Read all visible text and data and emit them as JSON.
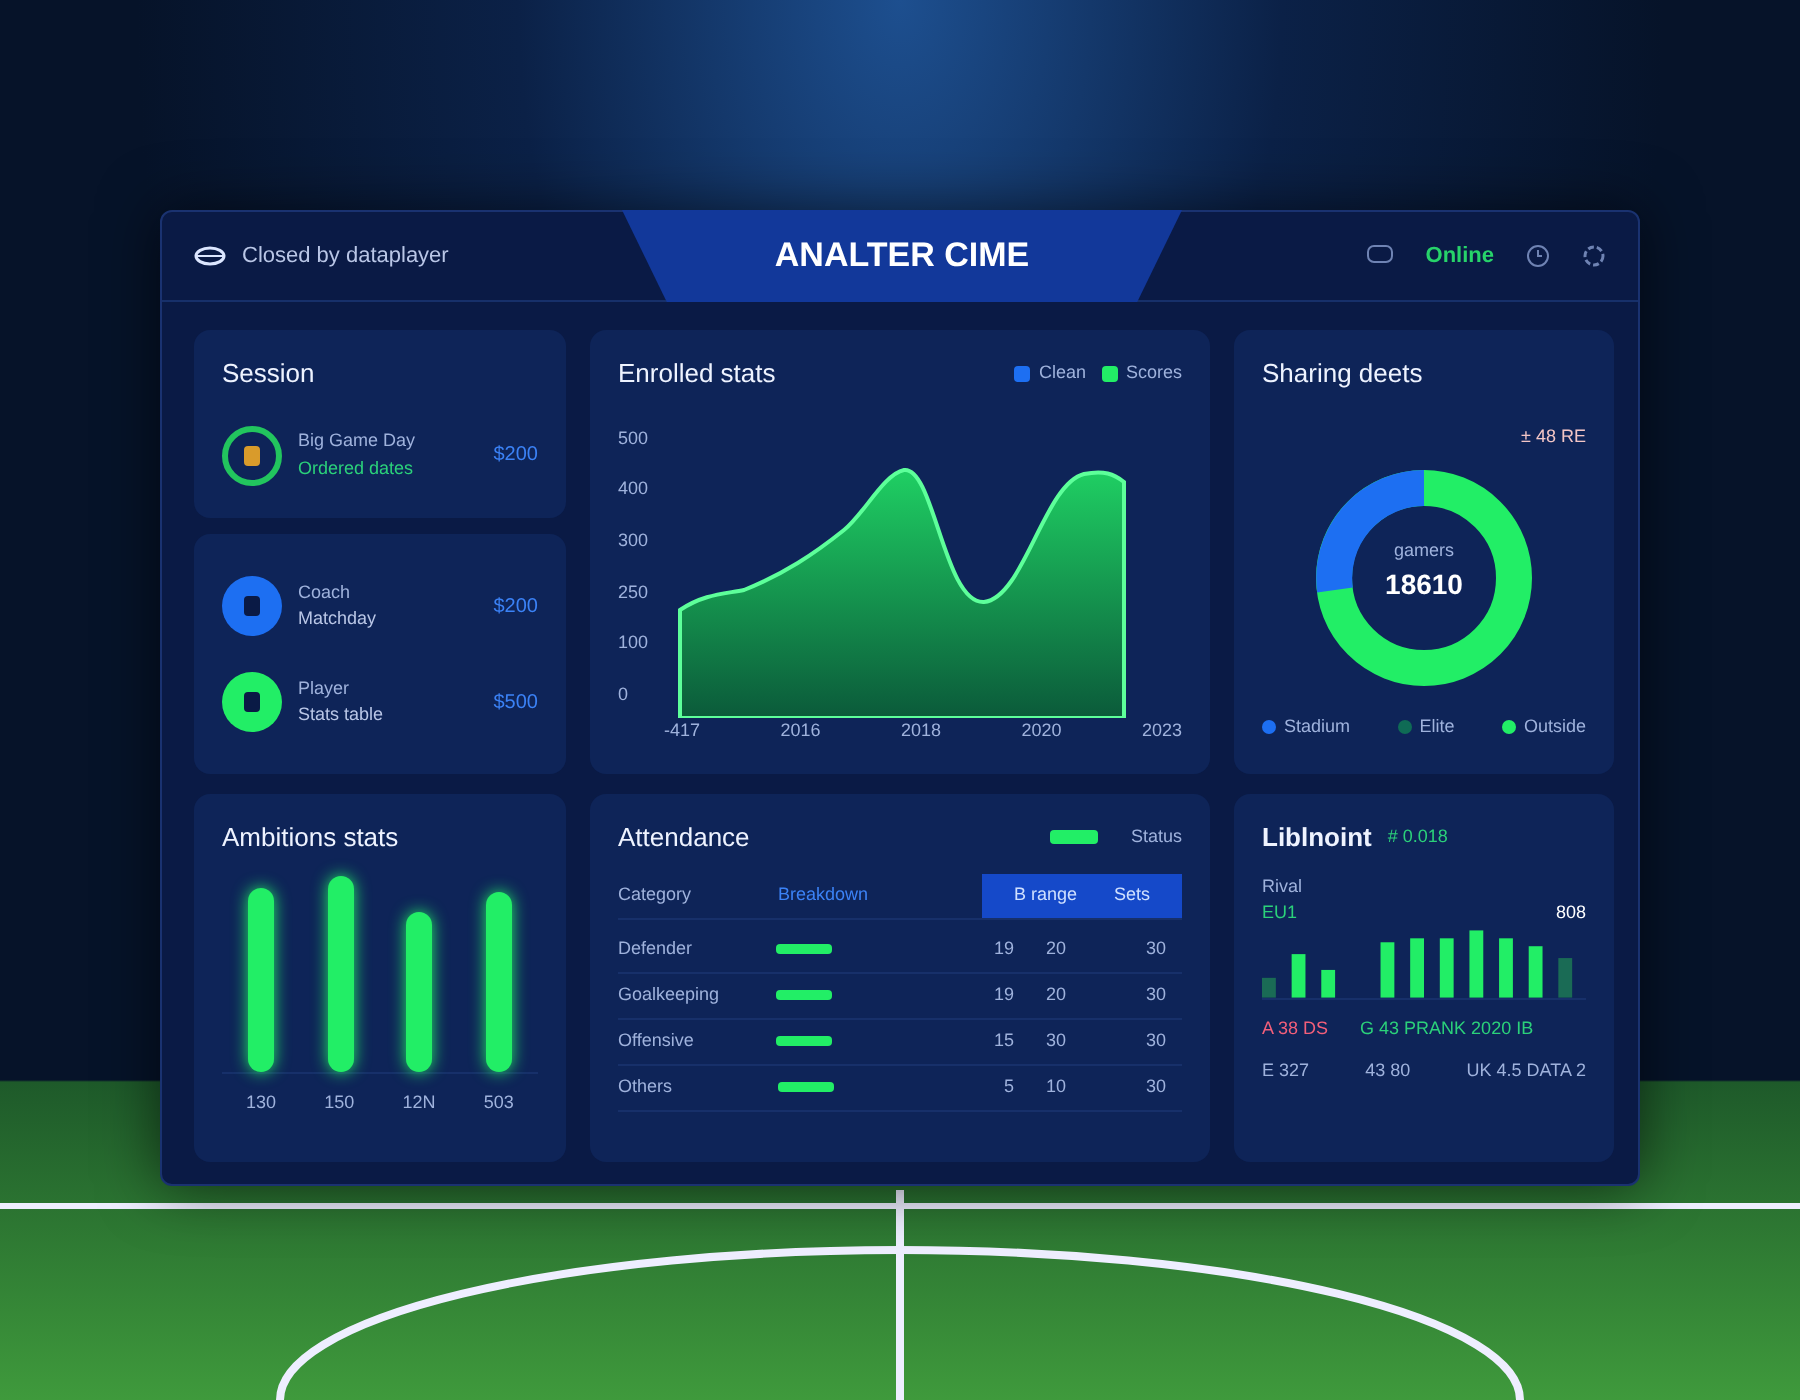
{
  "header": {
    "brand": "Closed by dataplayer",
    "title": "ANALTER CIME",
    "status": "Online"
  },
  "session": {
    "title": "Session",
    "items": [
      {
        "name": "Big Game Day",
        "detail": "Ordered dates",
        "value": "$200",
        "color": "#22c55e"
      }
    ]
  },
  "players": [
    {
      "name": "Coach",
      "detail": "Matchday",
      "value": "$200",
      "color": "#1d6ff2"
    },
    {
      "name": "Player",
      "detail": "Stats table",
      "value": "$500",
      "color": "#22ee66"
    }
  ],
  "trend": {
    "title": "Enrolled stats",
    "legend": [
      {
        "label": "Clean",
        "color": "#1d6ff2"
      },
      {
        "label": "Scores",
        "color": "#22ee66"
      }
    ],
    "y_labels": [
      "500",
      "400",
      "300",
      "250",
      "100",
      "0"
    ],
    "x_labels": [
      "-417",
      "2016",
      "2018",
      "2020",
      "2023"
    ]
  },
  "donut": {
    "title": "Sharing deets",
    "note": "± 48 RE",
    "center_label": "gamers",
    "center_value": "18610",
    "legend": [
      {
        "label": "Stadium",
        "color": "#1d6ff2"
      },
      {
        "label": "Elite",
        "color": "#0f6b55"
      },
      {
        "label": "Outside",
        "color": "#22ee66"
      }
    ]
  },
  "ambitions": {
    "title": "Ambitions stats",
    "labels": [
      "130",
      "150",
      "12N",
      "503"
    ]
  },
  "table": {
    "title": "Attendance",
    "legend": "Status",
    "header": [
      "Category",
      "Breakdown",
      "B range",
      "Sets"
    ],
    "rows": [
      {
        "name": "Defender",
        "c1": "19",
        "c2": "20",
        "c3": "30"
      },
      {
        "name": "Goalkeeping",
        "c1": "19",
        "c2": "20",
        "c3": "30"
      },
      {
        "name": "Offensive",
        "c1": "15",
        "c2": "30",
        "c3": "30"
      },
      {
        "name": "Others",
        "c1": "5",
        "c2": "10",
        "c3": "30"
      }
    ]
  },
  "live": {
    "title": "Liblnoint",
    "tag": "# 0.018",
    "axis_label": "Rival",
    "left_value": "EU1",
    "right_value": "808",
    "legend": [
      {
        "text": "A 38 DS",
        "kind": "loss"
      },
      {
        "text": "G 43 PRANK 2020 IB",
        "kind": "win"
      }
    ],
    "footer": [
      "E 327",
      "43 80",
      "UK 4.5 DATA 2"
    ]
  }
}
